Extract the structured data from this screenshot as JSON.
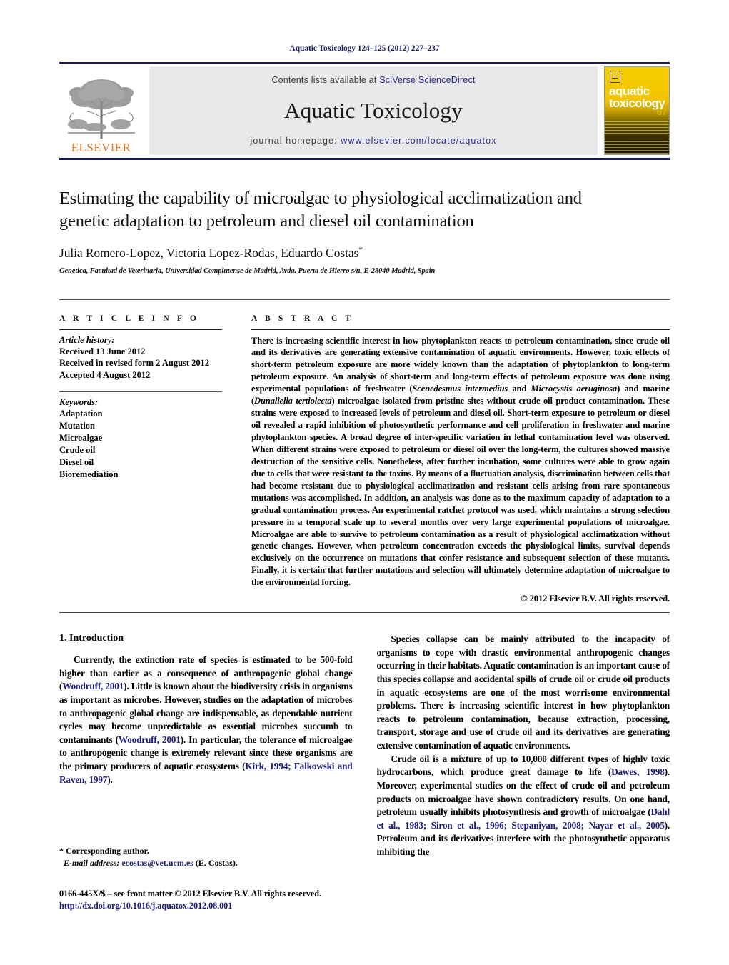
{
  "running_head": "Aquatic Toxicology 124–125 (2012) 227–237",
  "masthead": {
    "publisher_logo_label": "ELSEVIER",
    "contents_prefix": "Contents lists available at ",
    "contents_link": "SciVerse ScienceDirect",
    "journal_name": "Aquatic Toxicology",
    "homepage_prefix": "journal homepage: ",
    "homepage_url": "www.elsevier.com/locate/aquatox",
    "cover": {
      "line1": "aquatic",
      "line2": "toxicology",
      "volume_mark": "67"
    },
    "rule_color": "#1a1a5e",
    "band_color": "#e9e9ec",
    "cover_color": "#f2c400",
    "link_color": "#2b2b8f"
  },
  "article": {
    "title": "Estimating the capability of microalgae to physiological acclimatization and genetic adaptation to petroleum and diesel oil contamination",
    "authors": "Julia Romero-Lopez, Victoria Lopez-Rodas, Eduardo Costas",
    "corresponding_marker": "*",
    "affiliation": "Genetica, Facultad de Veterinaria, Universidad Complutense de Madrid, Avda. Puerta de Hierro s/n, E-28040 Madrid, Spain"
  },
  "article_info": {
    "heading": "A R T I C L E    I N F O",
    "history_label": "Article history:",
    "history": [
      "Received 13 June 2012",
      "Received in revised form 2 August 2012",
      "Accepted 4 August 2012"
    ],
    "keywords_label": "Keywords:",
    "keywords": [
      "Adaptation",
      "Mutation",
      "Microalgae",
      "Crude oil",
      "Diesel oil",
      "Bioremediation"
    ]
  },
  "abstract": {
    "heading": "A B S T R A C T",
    "part1": "There is increasing scientific interest in how phytoplankton reacts to petroleum contamination, since crude oil and its derivatives are generating extensive contamination of aquatic environments. However, toxic effects of short-term petroleum exposure are more widely known than the adaptation of phytoplankton to long-term petroleum exposure. An analysis of short-term and long-term effects of petroleum exposure was done using experimental populations of freshwater (",
    "italic1": "Scenedesmus intermedius",
    "part2": " and ",
    "italic2": "Microcystis aeruginosa",
    "part3": ") and marine (",
    "italic3": "Dunaliella tertiolecta",
    "part4": ") microalgae isolated from pristine sites without crude oil product contamination. These strains were exposed to increased levels of petroleum and diesel oil. Short-term exposure to petroleum or diesel oil revealed a rapid inhibition of photosynthetic performance and cell proliferation in freshwater and marine phytoplankton species. A broad degree of inter-specific variation in lethal contamination level was observed. When different strains were exposed to petroleum or diesel oil over the long-term, the cultures showed massive destruction of the sensitive cells. Nonetheless, after further incubation, some cultures were able to grow again due to cells that were resistant to the toxins. By means of a fluctuation analysis, discrimination between cells that had become resistant due to physiological acclimatization and resistant cells arising from rare spontaneous mutations was accomplished. In addition, an analysis was done as to the maximum capacity of adaptation to a gradual contamination process. An experimental ratchet protocol was used, which maintains a strong selection pressure in a temporal scale up to several months over very large experimental populations of microalgae. Microalgae are able to survive to petroleum contamination as a result of physiological acclimatization without genetic changes. However, when petroleum concentration exceeds the physiological limits, survival depends exclusively on the occurrence on mutations that confer resistance and subsequent selection of these mutants. Finally, it is certain that further mutations and selection will ultimately determine adaptation of microalgae to the environmental forcing.",
    "copyright": "© 2012 Elsevier B.V. All rights reserved."
  },
  "introduction": {
    "section_number_title": "1.  Introduction",
    "left_p1_a": "Currently, the extinction rate of species is estimated to be 500-fold higher than earlier as a consequence of anthropogenic global change (",
    "left_ref1": "Woodruff, 2001",
    "left_p1_b": "). Little is known about the biodiversity crisis in organisms as important as microbes. However, studies on the adaptation of microbes to anthropogenic global change are indispensable, as dependable nutrient cycles may become unpredictable as essential microbes succumb to contaminants (",
    "left_ref2": "Woodruff, 2001",
    "left_p1_c": "). In particular, the tolerance of microalgae to anthropogenic change is extremely relevant since these organisms are the primary producers of aquatic ecosystems (",
    "left_ref3": "Kirk, 1994; Falkowski and Raven, 1997",
    "left_p1_d": ").",
    "right_p1": "Species collapse can be mainly attributed to the incapacity of organisms to cope with drastic environmental anthropogenic changes occurring in their habitats. Aquatic contamination is an important cause of this species collapse and accidental spills of crude oil or crude oil products in aquatic ecosystems are one of the most worrisome environmental problems. There is increasing scientific interest in how phytoplankton reacts to petroleum contamination, because extraction, processing, transport, storage and use of crude oil and its derivatives are generating extensive contamination of aquatic environments.",
    "right_p2_a": "Crude oil is a mixture of up to 10,000 different types of highly toxic hydrocarbons, which produce great damage to life (",
    "right_ref1": "Dawes, 1998",
    "right_p2_b": "). Moreover, experimental studies on the effect of crude oil and petroleum products on microalgae have shown contradictory results. On one hand, petroleum usually inhibits photosynthesis and growth of microalgae (",
    "right_ref2": "Dahl et al., 1983; Siron et al., 1996; Stepaniyan, 2008; Nayar et al., 2005",
    "right_p2_c": "). Petroleum and its derivatives interfere with the photosynthetic apparatus inhibiting the",
    "reference_color": "#1c1c7a"
  },
  "footer": {
    "corresponding_author": "* Corresponding author.",
    "email_label": "E-mail address:",
    "email": "ecostas@vet.ucm.es",
    "email_suffix": " (E. Costas).",
    "issn_line": "0166-445X/$ – see front matter © 2012 Elsevier B.V. All rights reserved.",
    "doi": "http://dx.doi.org/10.1016/j.aquatox.2012.08.001"
  }
}
